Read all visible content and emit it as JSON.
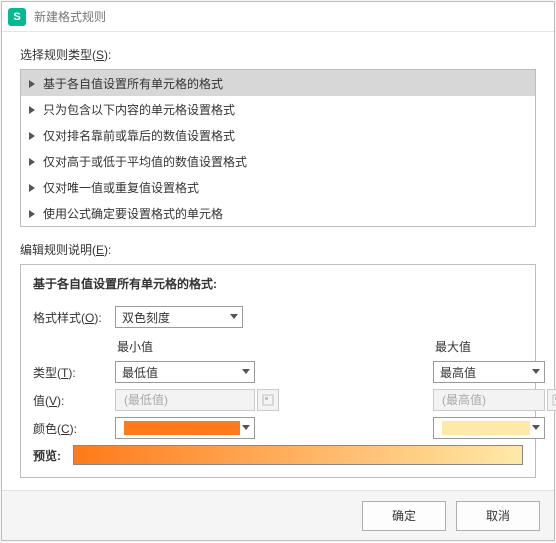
{
  "window": {
    "logo_text": "S",
    "title": "新建格式规则"
  },
  "ruleTypeSection": {
    "label_prefix": "选择规则类型(",
    "label_key": "S",
    "label_suffix": "):",
    "items": [
      {
        "label": "基于各自值设置所有单元格的格式",
        "selected": true
      },
      {
        "label": "只为包含以下内容的单元格设置格式",
        "selected": false
      },
      {
        "label": "仅对排名靠前或靠后的数值设置格式",
        "selected": false
      },
      {
        "label": "仅对高于或低于平均值的数值设置格式",
        "selected": false
      },
      {
        "label": "仅对唯一值或重复值设置格式",
        "selected": false
      },
      {
        "label": "使用公式确定要设置格式的单元格",
        "selected": false
      }
    ]
  },
  "editSection": {
    "label_prefix": "编辑规则说明(",
    "label_key": "E",
    "label_suffix": "):",
    "title": "基于各自值设置所有单元格的格式:",
    "formatStyle": {
      "label_prefix": "格式样式(",
      "label_key": "O",
      "label_suffix": "):",
      "value": "双色刻度"
    },
    "columns": {
      "min": "最小值",
      "max": "最大值"
    },
    "typeRow": {
      "label_prefix": "类型(",
      "label_key": "T",
      "label_suffix": "):",
      "min_value": "最低值",
      "max_value": "最高值"
    },
    "valueRow": {
      "label_prefix": "值(",
      "label_key": "V",
      "label_suffix": "):",
      "min_placeholder": "(最低值)",
      "max_placeholder": "(最高值)"
    },
    "colorRow": {
      "label_prefix": "颜色(",
      "label_key": "C",
      "label_suffix": "):",
      "min_color": "#ff7a1a",
      "max_color": "#ffe9a8"
    },
    "preview": {
      "label": "预览:",
      "gradient_from": "#ff7a1a",
      "gradient_to": "#ffe9a8"
    }
  },
  "footer": {
    "ok": "确定",
    "cancel": "取消"
  }
}
